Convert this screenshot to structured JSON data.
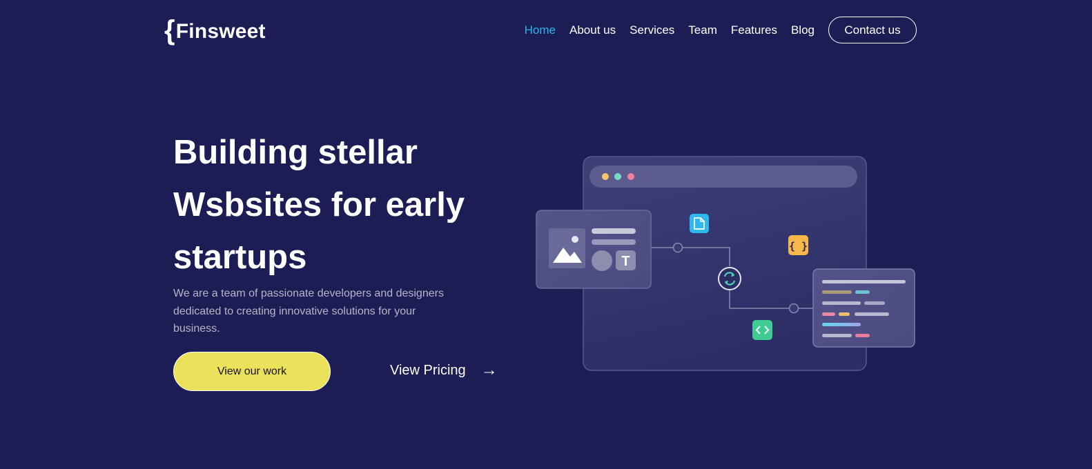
{
  "brand": {
    "brace": "{",
    "name": "Finsweet"
  },
  "nav": {
    "items": [
      "Home",
      "About us",
      "Services",
      "Team",
      "Features",
      "Blog"
    ],
    "active": "Home",
    "contact_label": "Contact us"
  },
  "hero": {
    "title_lines": [
      "Building stellar",
      "Wsbsites for early",
      "startups"
    ],
    "subtitle": "We are a team of passionate developers and designers dedicated to creating innovative solutions for your business.",
    "primary_button": "View our work",
    "secondary_button": "View Pricing",
    "secondary_arrow": "→"
  },
  "illustration": {
    "code_badge": "{ }",
    "text_badge": "T"
  },
  "colors": {
    "background": "#1d1d55",
    "accent_active": "#2bb7ea",
    "primary_button": "#ebe25b",
    "badge_blue": "#2db8f0",
    "badge_orange": "#f7b84a",
    "badge_green": "#3ecb94"
  }
}
